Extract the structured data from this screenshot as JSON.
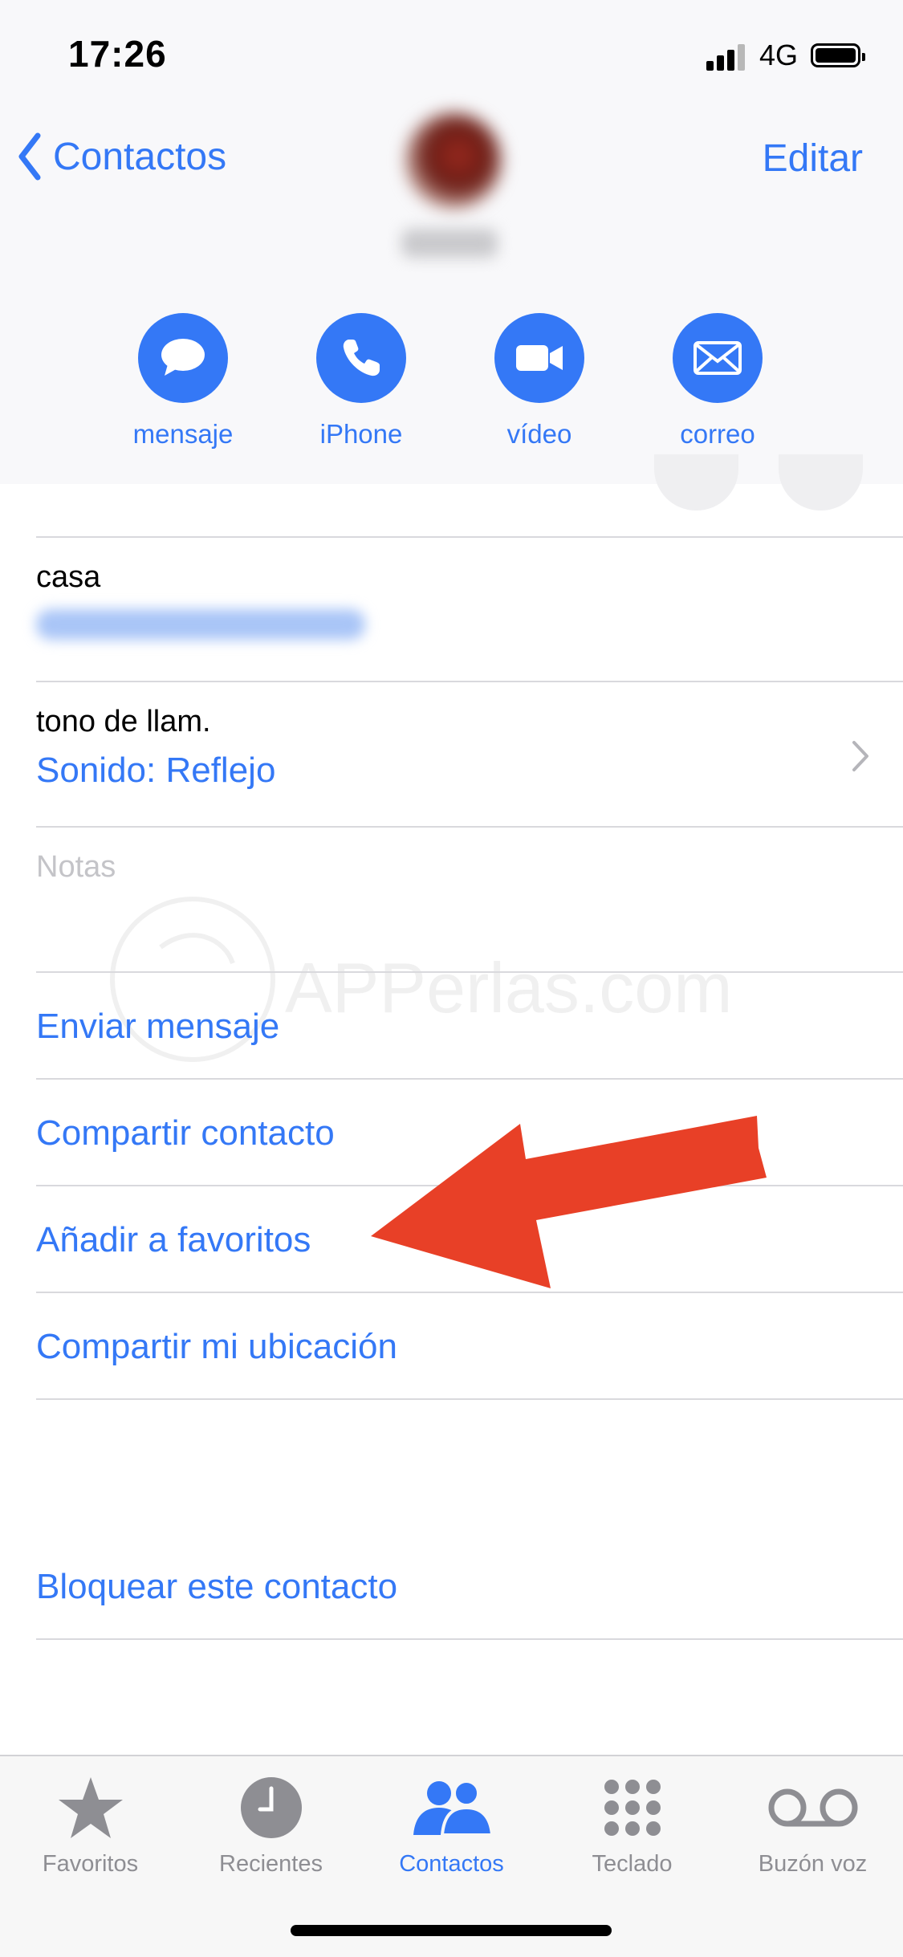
{
  "status": {
    "time": "17:26",
    "network": "4G"
  },
  "nav": {
    "back_label": "Contactos",
    "edit_label": "Editar"
  },
  "actions": [
    {
      "label": "mensaje",
      "icon": "message-bubble-icon"
    },
    {
      "label": "iPhone",
      "icon": "phone-icon"
    },
    {
      "label": "vídeo",
      "icon": "video-camera-icon"
    },
    {
      "label": "correo",
      "icon": "mail-envelope-icon"
    }
  ],
  "fields": {
    "email_label": "casa",
    "ringtone_label": "tono de llam.",
    "ringtone_value": "Sonido: Reflejo",
    "notes_label": "Notas"
  },
  "links": {
    "send_message": "Enviar mensaje",
    "share_contact": "Compartir contacto",
    "add_favorites": "Añadir a favoritos",
    "share_location": "Compartir mi ubicación",
    "block_contact": "Bloquear este contacto"
  },
  "watermark": "APPerlas.com",
  "tabs": [
    {
      "label": "Favoritos",
      "icon": "star-icon",
      "active": false
    },
    {
      "label": "Recientes",
      "icon": "clock-icon",
      "active": false
    },
    {
      "label": "Contactos",
      "icon": "contacts-people-icon",
      "active": true
    },
    {
      "label": "Teclado",
      "icon": "keypad-icon",
      "active": false
    },
    {
      "label": "Buzón voz",
      "icon": "voicemail-icon",
      "active": false
    }
  ],
  "colors": {
    "accent": "#3478f6",
    "arrow": "#e84027",
    "inactive": "#8e8e93"
  }
}
